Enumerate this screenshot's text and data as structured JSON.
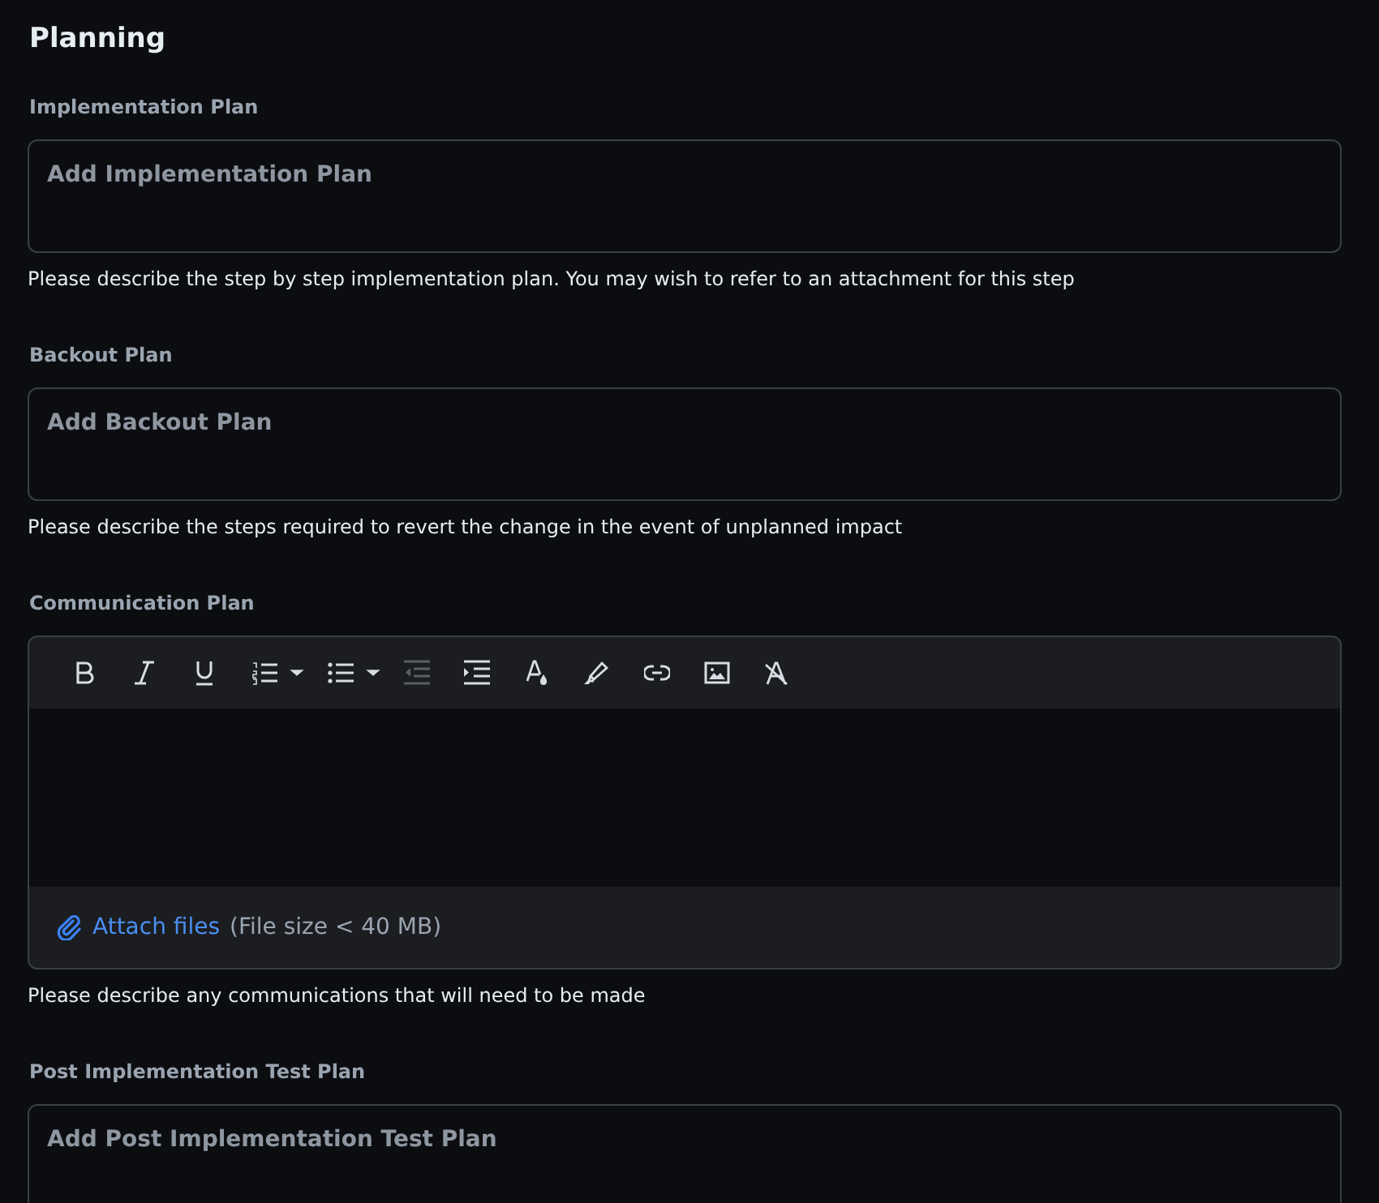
{
  "title": "Planning",
  "sections": [
    {
      "kind": "textarea",
      "label": "Implementation Plan",
      "placeholder": "Add Implementation Plan",
      "help": "Please describe the step by step implementation plan. You may wish to refer to an attachment for this step"
    },
    {
      "kind": "textarea",
      "label": "Backout Plan",
      "placeholder": "Add Backout Plan",
      "help": "Please describe the steps required to revert the change in the event of unplanned impact"
    },
    {
      "kind": "editor",
      "label": "Communication Plan",
      "toolbar": [
        {
          "kind": "bold",
          "disabled": false
        },
        {
          "kind": "italic",
          "disabled": false
        },
        {
          "kind": "underline",
          "disabled": false
        },
        {
          "kind": "ordered-list",
          "disabled": false
        },
        {
          "kind": "dropdown",
          "disabled": false
        },
        {
          "kind": "bullet-list",
          "disabled": false
        },
        {
          "kind": "dropdown",
          "disabled": false
        },
        {
          "kind": "outdent",
          "disabled": true
        },
        {
          "kind": "indent",
          "disabled": false
        },
        {
          "kind": "text-color",
          "disabled": false
        },
        {
          "kind": "highlight",
          "disabled": false
        },
        {
          "kind": "link",
          "disabled": false
        },
        {
          "kind": "image",
          "disabled": false
        },
        {
          "kind": "clear-format",
          "disabled": false
        }
      ],
      "attach_link": "Attach files",
      "attach_note": "(File size < 40 MB)",
      "help": "Please describe any communications that will need to be made"
    },
    {
      "kind": "textarea",
      "label": "Post Implementation Test Plan",
      "placeholder": "Add Post Implementation Test Plan"
    }
  ]
}
